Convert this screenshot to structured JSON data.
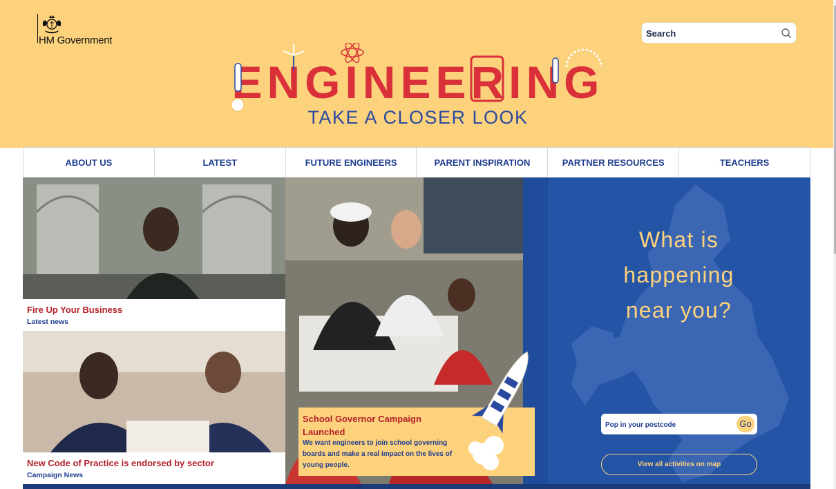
{
  "header": {
    "logo_text": "HM Government",
    "search": {
      "placeholder": "Search"
    },
    "brand_title": "ENGINEERING",
    "tagline": "TAKE A CLOSER LOOK"
  },
  "nav": {
    "items": [
      {
        "label": "ABOUT US"
      },
      {
        "label": "LATEST"
      },
      {
        "label": "FUTURE ENGINEERS"
      },
      {
        "label": "PARENT INSPIRATION"
      },
      {
        "label": "PARTNER RESOURCES"
      },
      {
        "label": "TEACHERS"
      }
    ]
  },
  "cards": [
    {
      "title": "Fire Up Your Business",
      "subtitle": "Latest news"
    },
    {
      "title": "New Code of Practice is endorsed by sector",
      "subtitle": "Campaign News"
    }
  ],
  "featured": {
    "title": "School Governor Campaign Launched",
    "description": "We want engineers to join school governing boards and make a real impact on the lives of young people."
  },
  "map": {
    "heading_line1": "What is",
    "heading_line2": "happening",
    "heading_line3": "near you?",
    "postcode_placeholder": "Pop in your postcode",
    "go_label": "Go",
    "view_all_label": "View all activities on map"
  },
  "colors": {
    "header_bg": "#fdd27c",
    "accent_red": "#b3202a",
    "brand_blue": "#1e3d8f",
    "map_blue": "#2454a6"
  }
}
